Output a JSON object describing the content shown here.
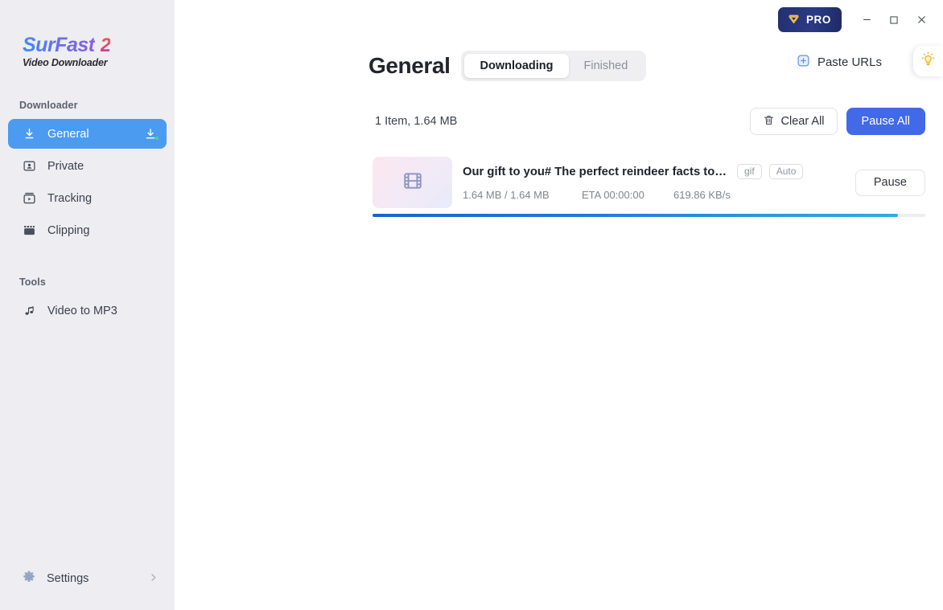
{
  "app": {
    "logo_main": "SurFast",
    "logo_accent": "2",
    "logo_sub": "Video Downloader"
  },
  "titlebar": {
    "pro_label": "PRO",
    "minimize": "minimize-button",
    "maximize": "maximize-button",
    "close": "close-button"
  },
  "sidebar": {
    "sections": [
      {
        "label": "Downloader",
        "items": [
          {
            "label": "General",
            "icon": "download-arrow-icon",
            "active": true,
            "trailing_icon": "download-tray-icon"
          },
          {
            "label": "Private",
            "icon": "private-person-icon",
            "active": false
          },
          {
            "label": "Tracking",
            "icon": "tracking-video-icon",
            "active": false
          },
          {
            "label": "Clipping",
            "icon": "clipping-film-icon",
            "active": false
          }
        ]
      },
      {
        "label": "Tools",
        "items": [
          {
            "label": "Video to MP3",
            "icon": "music-note-icon",
            "active": false
          }
        ]
      }
    ],
    "settings": {
      "label": "Settings",
      "icon": "gear-icon",
      "chevron": "chevron-right-icon"
    }
  },
  "header": {
    "title": "General",
    "tabs": [
      {
        "label": "Downloading",
        "active": true
      },
      {
        "label": "Finished",
        "active": false
      }
    ],
    "paste_urls_label": "Paste URLs",
    "paste_urls_icon": "plus-square-icon",
    "lightbulb_icon": "lightbulb-icon"
  },
  "toolbar": {
    "count_text": "1 Item, 1.64 MB",
    "clear_all_label": "Clear All",
    "clear_all_icon": "trash-icon",
    "pause_all_label": "Pause All"
  },
  "downloads": [
    {
      "title": "Our gift to you# The perfect reindeer facts to sh...",
      "thumb_icon": "film-strip-icon",
      "format_chip": "gif",
      "quality_chip": "Auto",
      "size": "1.64 MB / 1.64 MB",
      "eta": "ETA 00:00:00",
      "speed": "619.86 KB/s",
      "action_label": "Pause",
      "progress_percent": 95
    }
  ],
  "colors": {
    "sidebar_bg": "#eeedf1",
    "accent_blue": "#4b9bf0",
    "primary_button": "#4169e8",
    "pro_navy": "#23306f",
    "pro_gold": "#f2c14e",
    "lightbulb_yellow": "#f6b528",
    "progress_start": "#1566cf",
    "progress_end": "#31aaea"
  }
}
